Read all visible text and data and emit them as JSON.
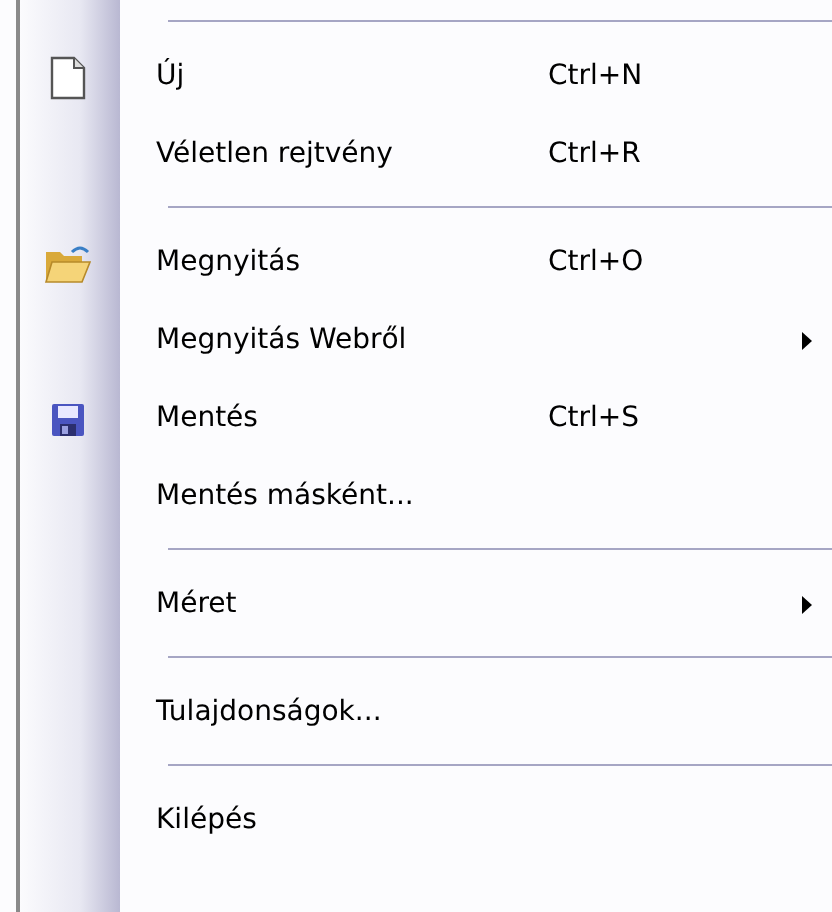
{
  "menu": {
    "items": [
      {
        "kind": "separator"
      },
      {
        "kind": "new",
        "label": "Új",
        "shortcut": "Ctrl+N",
        "submenu": false
      },
      {
        "kind": "item",
        "label": "Véletlen rejtvény",
        "shortcut": "Ctrl+R",
        "submenu": false
      },
      {
        "kind": "separator"
      },
      {
        "kind": "open",
        "label": "Megnyitás",
        "shortcut": "Ctrl+O",
        "submenu": false
      },
      {
        "kind": "item",
        "label": "Megnyitás Webről",
        "submenu": true
      },
      {
        "kind": "save",
        "label": "Mentés",
        "shortcut": "Ctrl+S",
        "submenu": false
      },
      {
        "kind": "item",
        "label": "Mentés másként...",
        "submenu": false
      },
      {
        "kind": "separator"
      },
      {
        "kind": "item",
        "label": "Méret",
        "submenu": true
      },
      {
        "kind": "separator"
      },
      {
        "kind": "item",
        "label": "Tulajdonságok...",
        "submenu": false
      },
      {
        "kind": "separator"
      },
      {
        "kind": "item",
        "label": "Kilépés",
        "submenu": false
      }
    ]
  }
}
